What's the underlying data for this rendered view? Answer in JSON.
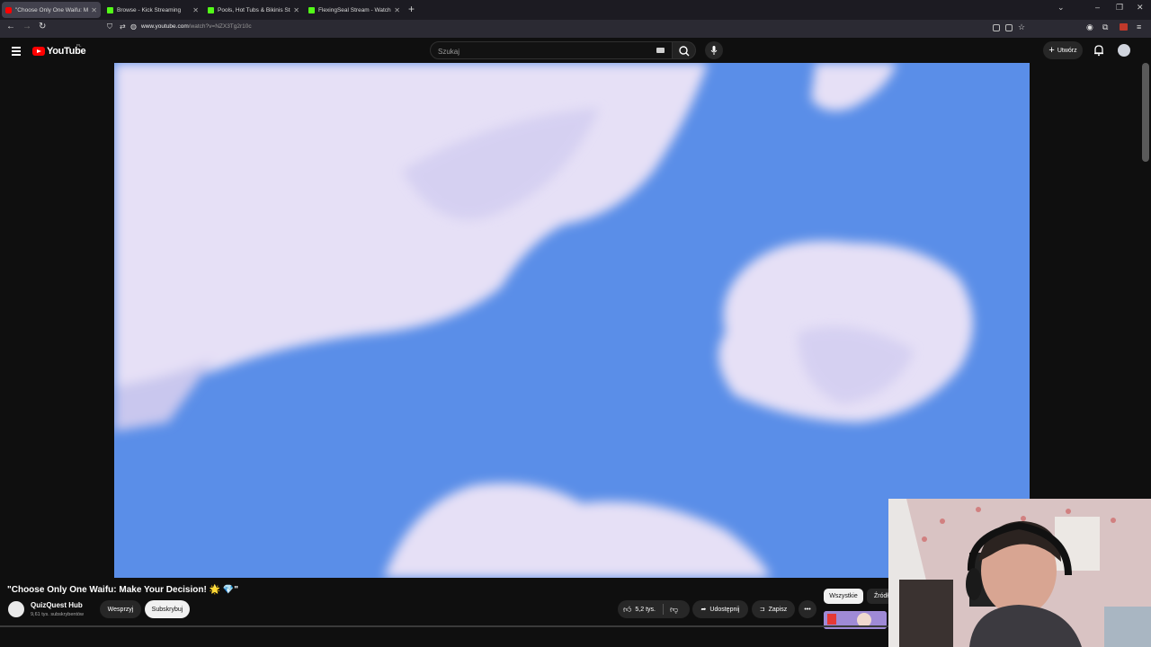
{
  "browser": {
    "tabs": [
      {
        "title": "\"Choose Only One Waifu: Make",
        "favicon": "youtube-icon",
        "active": true
      },
      {
        "title": "Browse - Kick Streaming",
        "favicon": "kick-icon",
        "active": false
      },
      {
        "title": "Pools, Hot Tubs & Bikinis Strea",
        "favicon": "kick-icon",
        "active": false
      },
      {
        "title": "FlexingSeal Stream - Watch Liv",
        "favicon": "kick-icon",
        "active": false
      }
    ],
    "url_domain": "www.youtube.com",
    "url_path": "/watch?v=NZX3Tg2r10c"
  },
  "youtube": {
    "logo_text": "YouTube",
    "region": "PL",
    "search_placeholder": "Szukaj",
    "create_label": "Utwórz"
  },
  "video": {
    "title": "\"Choose Only One Waifu: Make Your Decision! 🌟 💎\"",
    "channel_name": "QuizQuest Hub",
    "channel_subs": "9,61 tys. subskrybentów",
    "support_label": "Wesprzyj",
    "subscribe_label": "Subskrybuj",
    "likes": "5,2 tys.",
    "share_label": "Udostępnij",
    "save_label": "Zapisz"
  },
  "sidebar": {
    "chips": [
      "Wszystkie",
      "Źródł"
    ]
  },
  "colors": {
    "sky": "#5b8fe9",
    "cloud": "#e8e2f6",
    "subscribe_bg": "#f1f1f1",
    "yt_red": "#ff0000"
  }
}
